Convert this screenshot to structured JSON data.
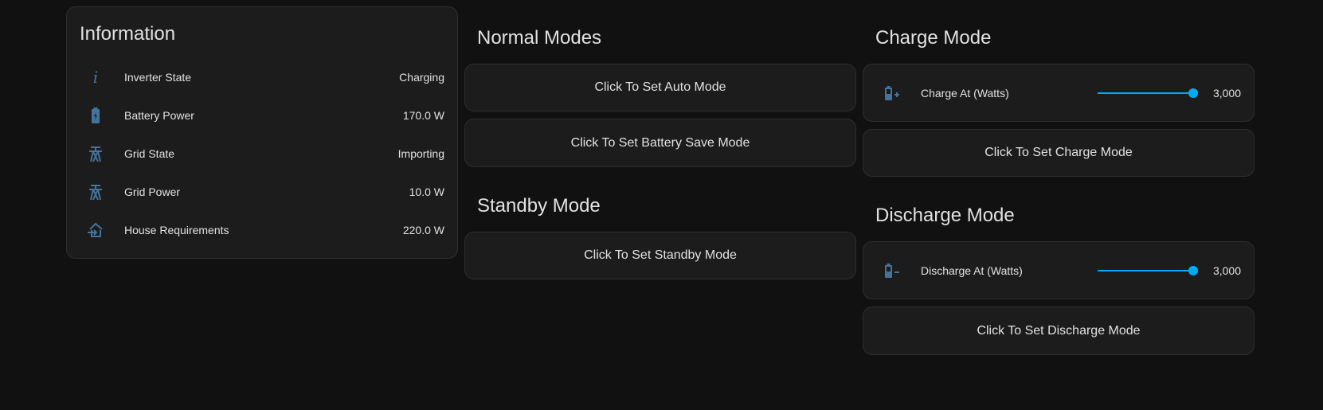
{
  "colors": {
    "background": "#111111",
    "card": "#1c1c1c",
    "icon": "#44739e",
    "accent": "#03a9f4",
    "text": "#e1e1e1"
  },
  "information": {
    "title": "Information",
    "rows": [
      {
        "icon": "information-icon",
        "label": "Inverter State",
        "value": "Charging"
      },
      {
        "icon": "battery-charging-icon",
        "label": "Battery Power",
        "value": "170.0 W"
      },
      {
        "icon": "transmission-tower-icon",
        "label": "Grid State",
        "value": "Importing"
      },
      {
        "icon": "transmission-tower-icon",
        "label": "Grid Power",
        "value": "10.0 W"
      },
      {
        "icon": "home-import-icon",
        "label": "House Requirements",
        "value": "220.0 W"
      }
    ]
  },
  "normal_modes": {
    "title": "Normal Modes",
    "buttons": [
      "Click To Set Auto Mode",
      "Click To Set Battery Save Mode"
    ]
  },
  "standby_mode": {
    "title": "Standby Mode",
    "button": "Click To Set Standby Mode"
  },
  "charge_mode": {
    "title": "Charge Mode",
    "slider": {
      "icon": "battery-plus-icon",
      "label": "Charge At (Watts)",
      "value": "3,000",
      "fraction": 1.0
    },
    "button": "Click To Set Charge Mode"
  },
  "discharge_mode": {
    "title": "Discharge Mode",
    "slider": {
      "icon": "battery-minus-icon",
      "label": "Discharge At (Watts)",
      "value": "3,000",
      "fraction": 1.0
    },
    "button": "Click To Set Discharge Mode"
  }
}
